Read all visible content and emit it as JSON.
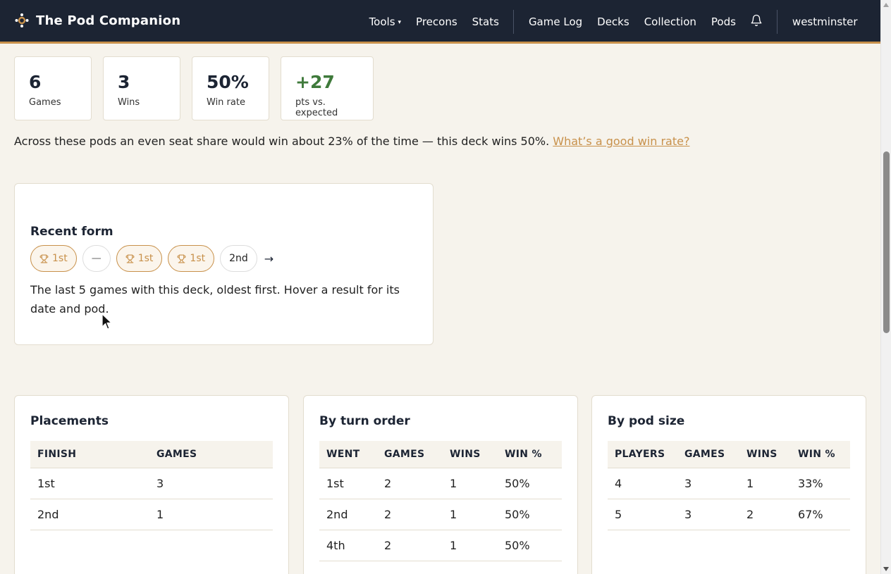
{
  "nav": {
    "brand": "The Pod Companion",
    "tools": "Tools",
    "precons": "Precons",
    "stats": "Stats",
    "game_log": "Game Log",
    "decks": "Decks",
    "collection": "Collection",
    "pods": "Pods",
    "user": "westminster",
    "bell_icon": "bell-icon"
  },
  "stats": [
    {
      "value": "6",
      "label": "Games"
    },
    {
      "value": "3",
      "label": "Wins"
    },
    {
      "value": "50%",
      "label": "Win rate"
    },
    {
      "value": "+27",
      "label": "pts vs. expected"
    }
  ],
  "summary": {
    "text": "Across these pods an even seat share would win about 23% of the time — this deck wins 50%.",
    "link": "What’s a good win rate?"
  },
  "recent_form": {
    "title": "Recent form",
    "results": [
      "1st",
      "—",
      "1st",
      "1st",
      "2nd"
    ],
    "arrow": "→",
    "note": "The last 5 games with this deck, oldest first. Hover a result for its date and pod."
  },
  "placements": {
    "title": "Placements",
    "headers": [
      "FINISH",
      "GAMES"
    ],
    "rows": [
      [
        "1st",
        "3"
      ],
      [
        "2nd",
        "1"
      ]
    ]
  },
  "turn_order": {
    "title": "By turn order",
    "headers": [
      "WENT",
      "GAMES",
      "WINS",
      "WIN %"
    ],
    "rows": [
      [
        "1st",
        "2",
        "1",
        "50%"
      ],
      [
        "2nd",
        "2",
        "1",
        "50%"
      ],
      [
        "4th",
        "2",
        "1",
        "50%"
      ]
    ]
  },
  "pod_size": {
    "title": "By pod size",
    "headers": [
      "PLAYERS",
      "GAMES",
      "WINS",
      "WIN %"
    ],
    "rows": [
      [
        "4",
        "3",
        "1",
        "33%"
      ],
      [
        "5",
        "3",
        "2",
        "67%"
      ]
    ]
  },
  "colors": {
    "nav_bg": "#1c2433",
    "accent": "#c8914b",
    "page_bg": "#f6f3ec",
    "positive": "#3f7a3b"
  }
}
